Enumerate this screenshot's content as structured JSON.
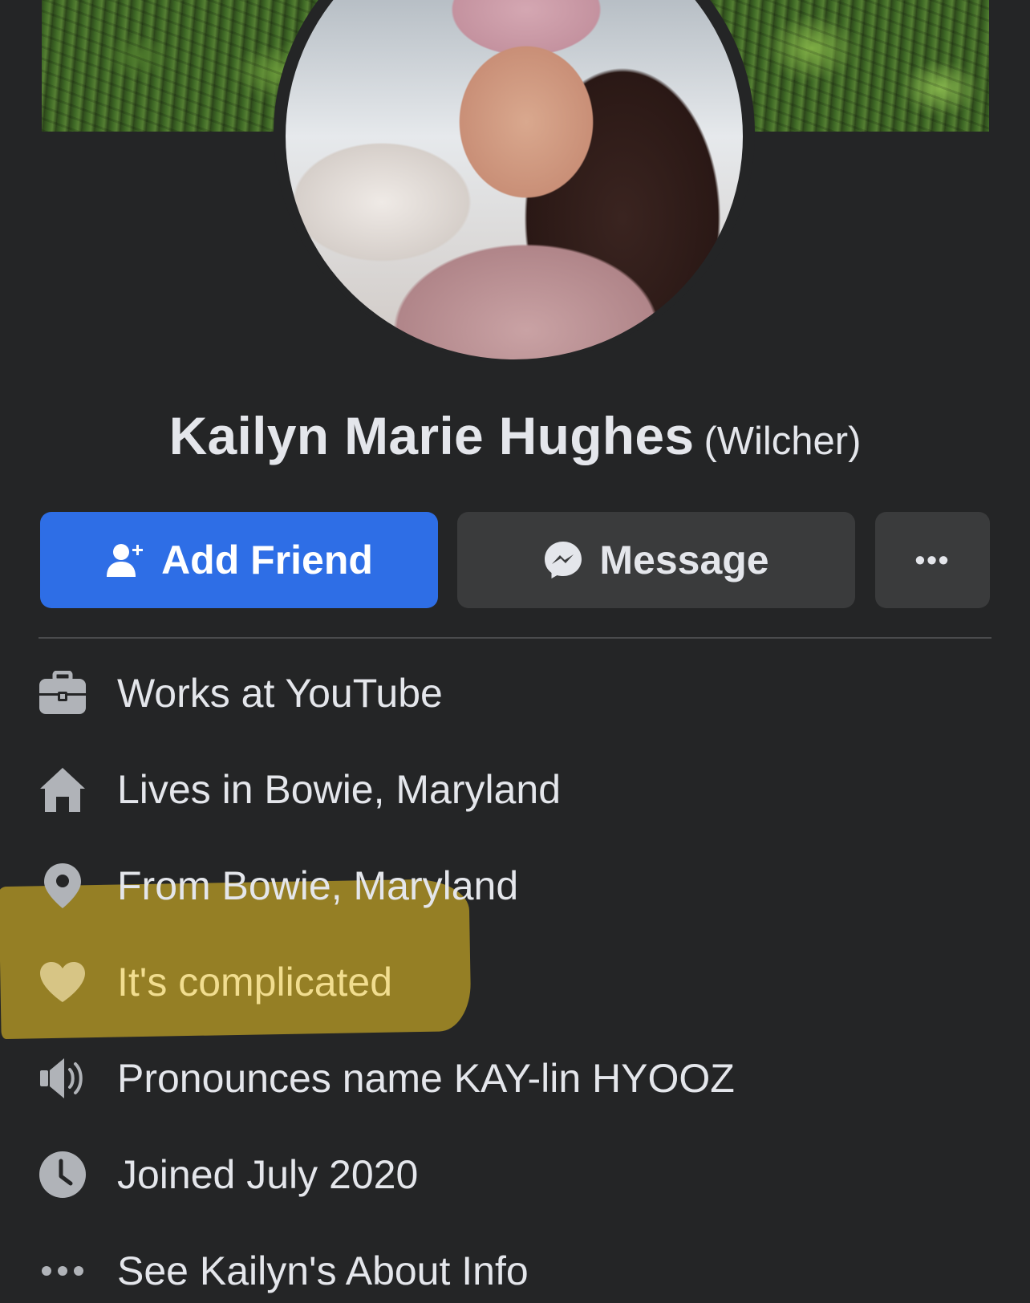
{
  "profile": {
    "name": "Kailyn Marie Hughes",
    "alternate_name": "(Wilcher)"
  },
  "actions": {
    "add_friend": "Add Friend",
    "message": "Message",
    "more": "•••"
  },
  "intro": [
    {
      "icon": "briefcase-icon",
      "text": "Works at YouTube"
    },
    {
      "icon": "home-icon",
      "text": "Lives in Bowie, Maryland"
    },
    {
      "icon": "location-pin-icon",
      "text": "From Bowie, Maryland"
    },
    {
      "icon": "heart-icon",
      "text": "It's complicated"
    },
    {
      "icon": "speaker-icon",
      "text": "Pronounces name KAY-lin HYOOZ"
    },
    {
      "icon": "clock-icon",
      "text": "Joined July 2020"
    },
    {
      "icon": "more-dots-icon",
      "text": "See Kailyn's About Info"
    }
  ],
  "colors": {
    "background": "#242526",
    "primary_button": "#2e6ee6",
    "secondary_button": "#3a3b3c",
    "text": "#e4e6eb",
    "icon": "#b0b3b8",
    "highlight": "#af9426"
  }
}
